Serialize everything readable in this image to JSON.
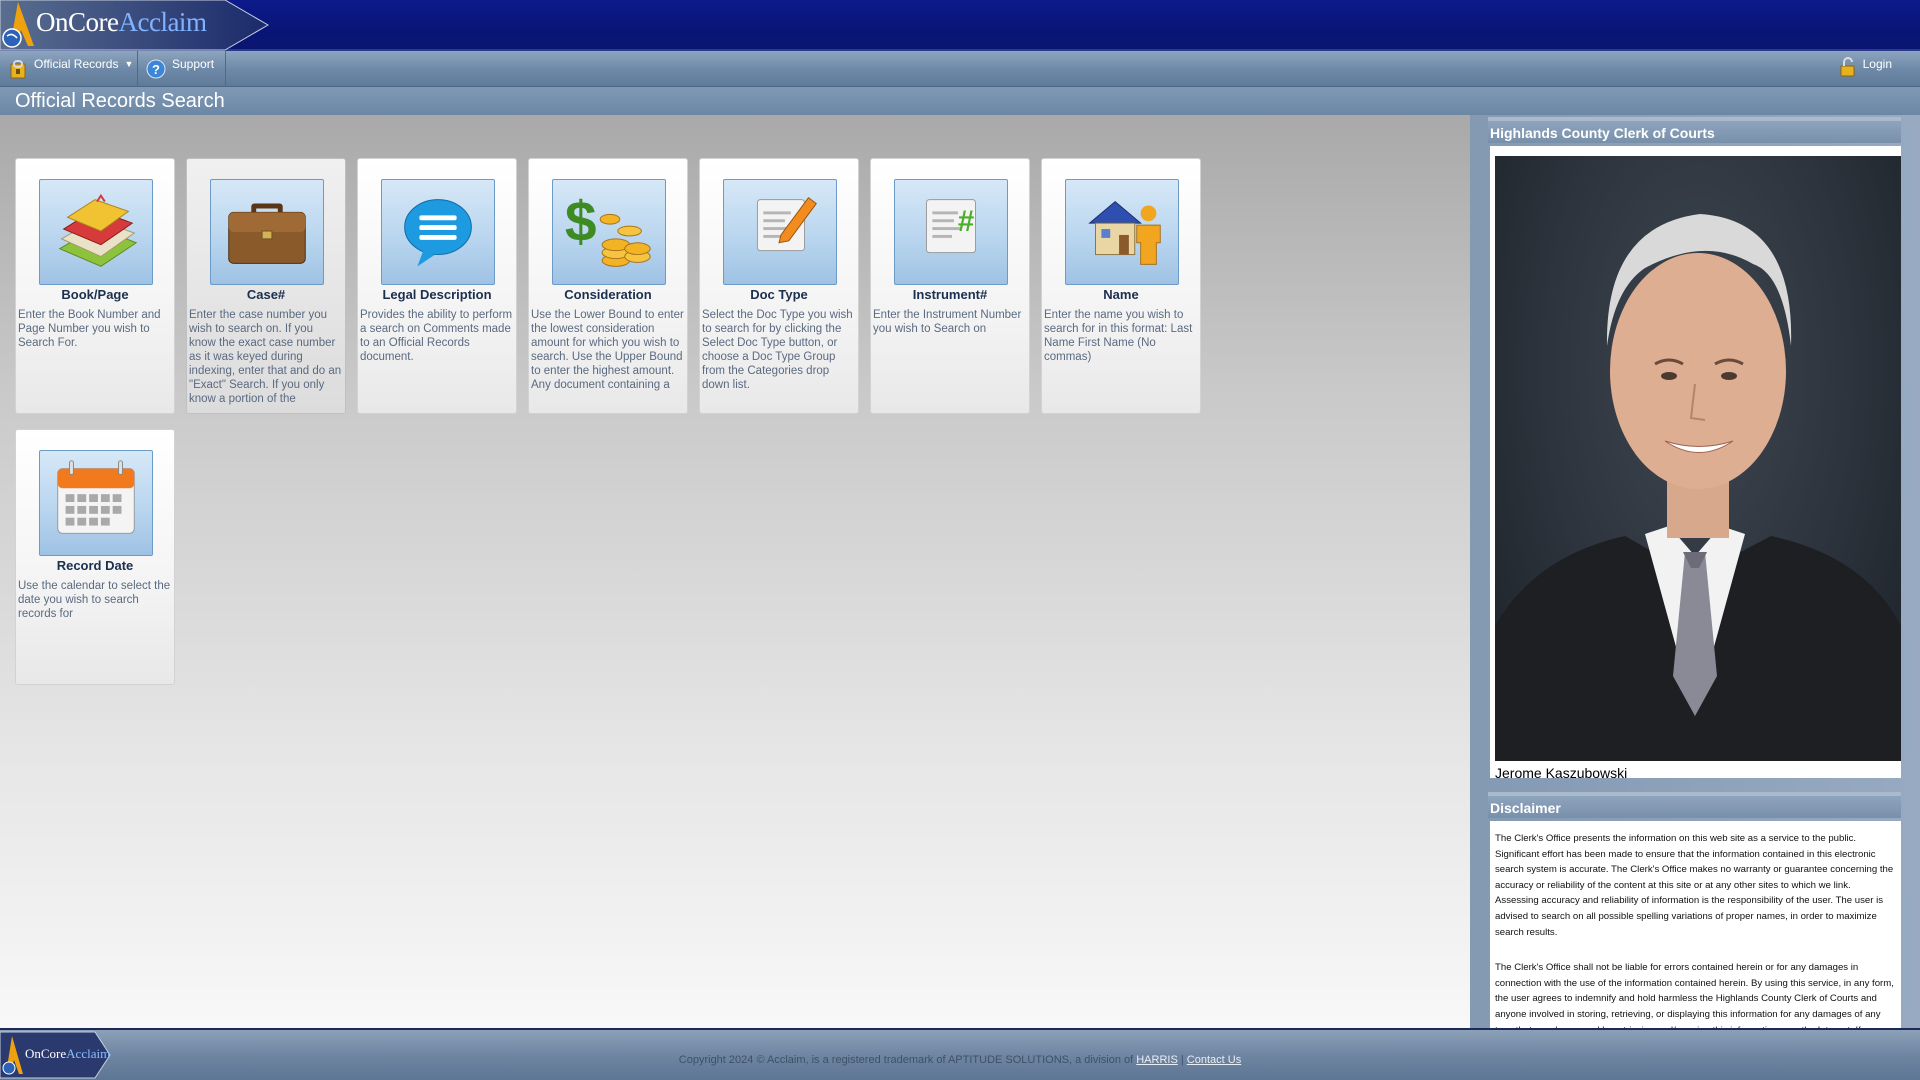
{
  "app": {
    "logo_main": "OnCore",
    "logo_accent": "Acclaim"
  },
  "nav": {
    "official_records": "Official Records",
    "support": "Support",
    "login": "Login"
  },
  "page_title": "Official Records Search",
  "tiles": [
    {
      "label": "Book/Page",
      "desc": "Enter the Book Number and Page Number you wish to Search For.",
      "icon": "books-icon"
    },
    {
      "label": "Case#",
      "desc": "Enter the case number you wish to search on. If you know the exact case number as it was keyed during indexing, enter that and do an \"Exact\" Search. If you only know a portion of the",
      "icon": "briefcase-icon"
    },
    {
      "label": "Legal Description",
      "desc": "Provides the ability to perform a search on Comments made to an Official Records document.",
      "icon": "speech-bubble-icon"
    },
    {
      "label": "Consideration",
      "desc": "Use the Lower Bound to enter the lowest consideration amount for which you wish to search. Use the Upper Bound to enter the highest amount. Any document containing a",
      "icon": "dollar-coins-icon"
    },
    {
      "label": "Doc Type",
      "desc": "Select the Doc Type you wish to search for by clicking the Select Doc Type button, or choose a Doc Type Group from the Categories drop down list.",
      "icon": "document-pencil-icon"
    },
    {
      "label": "Instrument#",
      "desc": "Enter the Instrument Number you wish to Search on",
      "icon": "document-hash-icon"
    },
    {
      "label": "Name",
      "desc": "Enter the name you wish to search for in this format: Last Name First Name (No commas)",
      "icon": "house-person-icon"
    },
    {
      "label": "Record Date",
      "desc": "Use the calendar to select the date you wish to search records for",
      "icon": "calendar-icon"
    }
  ],
  "sidebar": {
    "clerk_title": "Highlands County Clerk of Courts",
    "clerk_name": "Jerome Kaszubowski",
    "disclaimer_title": "Disclaimer",
    "disclaimer_p1": "The Clerk's Office presents the information on this web site as a service to the public. Significant effort has been made to ensure that the information contained in this electronic search system is accurate. The Clerk's Office makes no warranty or guarantee concerning the accuracy or reliability of the content at this site or at any other sites to which we link. Assessing accuracy and reliability of information is the responsibility of the user. The user is advised to search on all possible spelling variations of proper names, in order to maximize search results.",
    "disclaimer_p2": "The Clerk's Office shall not be liable for errors contained herein or for any damages in connection with the use of the information contained herein. By using this service, in any form, the user agrees to indemnify and hold harmless the Highlands County Clerk of Courts and anyone involved in storing, retrieving, or displaying this information for any damages of any type that may be caused by retrieving and/or using this information over the Internet. If you"
  },
  "footer": {
    "copyright": "Copyright 2024 © Acclaim, is a registered trademark of APTITUDE SOLUTIONS, a division of ",
    "harris": "HARRIS",
    "separator": " | ",
    "contact": "Contact Us"
  },
  "colors": {
    "header": "#0c1a8c",
    "nav": "#7f99b5",
    "tile_label": "#1b2f4e",
    "tile_desc": "#5a6a80"
  }
}
